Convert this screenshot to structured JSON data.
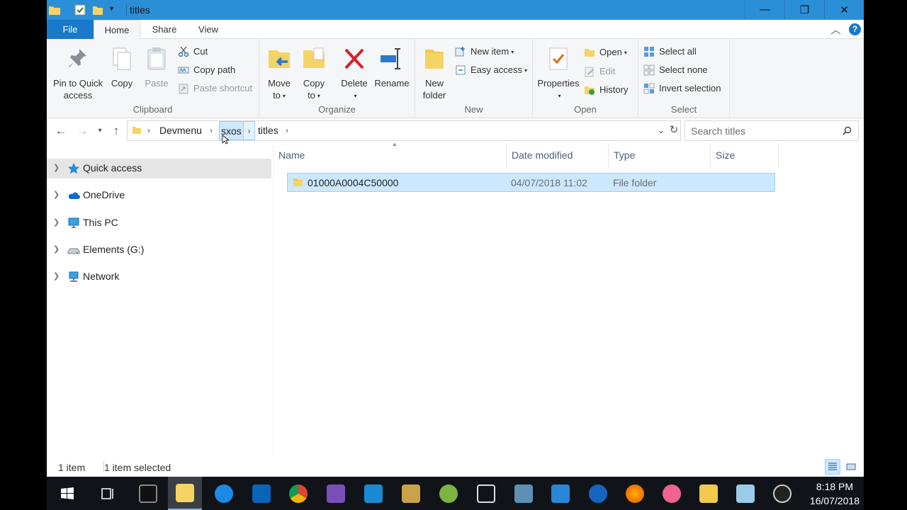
{
  "window": {
    "title": "titles",
    "controls": {
      "minimize": "—",
      "maximize": "❐",
      "close": "✕"
    }
  },
  "tabs": {
    "file": "File",
    "home": "Home",
    "share": "Share",
    "view": "View",
    "help": "?"
  },
  "ribbon": {
    "clipboard": {
      "label": "Clipboard",
      "pin_line1": "Pin to Quick",
      "pin_line2": "access",
      "copy": "Copy",
      "paste": "Paste",
      "cut": "Cut",
      "copy_path": "Copy path",
      "paste_shortcut": "Paste shortcut"
    },
    "organize": {
      "label": "Organize",
      "move_line1": "Move",
      "move_line2": "to",
      "copy_line1": "Copy",
      "copy_line2": "to",
      "delete": "Delete",
      "rename": "Rename"
    },
    "new": {
      "label": "New",
      "folder_line1": "New",
      "folder_line2": "folder",
      "new_item": "New item",
      "easy_access": "Easy access"
    },
    "open": {
      "label": "Open",
      "properties": "Properties",
      "open": "Open",
      "edit": "Edit",
      "history": "History"
    },
    "select": {
      "label": "Select",
      "select_all": "Select all",
      "select_none": "Select none",
      "invert": "Invert selection"
    }
  },
  "address": {
    "crumbs": [
      "Devmenu",
      "sxos",
      "titles"
    ],
    "search_placeholder": "Search titles"
  },
  "navpane": {
    "items": [
      {
        "label": "Quick access",
        "icon": "star-icon"
      },
      {
        "label": "OneDrive",
        "icon": "cloud-icon"
      },
      {
        "label": "This PC",
        "icon": "computer-icon"
      },
      {
        "label": "Elements (G:)",
        "icon": "drive-icon"
      },
      {
        "label": "Network",
        "icon": "network-icon"
      }
    ]
  },
  "columns": {
    "name": "Name",
    "date": "Date modified",
    "type": "Type",
    "size": "Size"
  },
  "files": [
    {
      "name": "01000A0004C50000",
      "date": "04/07/2018 11:02",
      "type": "File folder",
      "size": ""
    }
  ],
  "status": {
    "count": "1 item",
    "selected": "1 item selected"
  },
  "clock": {
    "time": "8:18 PM",
    "date": "16/07/2018"
  },
  "colors": {
    "accent": "#1979ca",
    "titlebar": "#2b8fd8",
    "selection": "#cce8ff",
    "taskbar": "#101418"
  }
}
